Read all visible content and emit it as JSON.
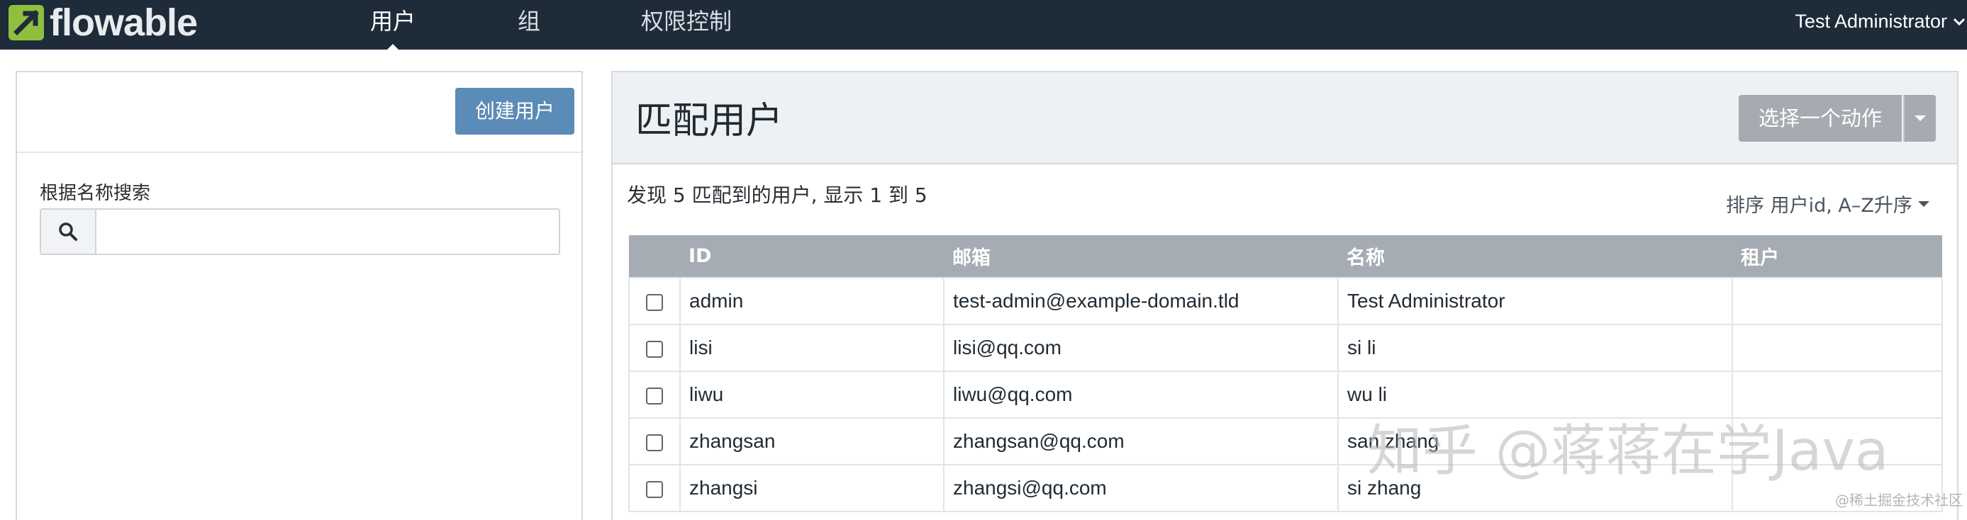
{
  "app": {
    "logo_text": "flowable",
    "nav": [
      "用户",
      "组",
      "权限控制"
    ],
    "user_menu": "Test Administrator"
  },
  "left_panel": {
    "create_button": "创建用户",
    "search_label": "根据名称搜索",
    "search_value": "",
    "search_icon": "search-icon"
  },
  "main": {
    "title": "匹配用户",
    "action_button": "选择一个动作",
    "result_summary": "发现 5 匹配到的用户, 显示 1 到 5",
    "sort": "排序 用户id, A–Z升序",
    "table": {
      "headers": [
        "",
        "ID",
        "邮箱",
        "名称",
        "租户"
      ],
      "rows": [
        {
          "id": "admin",
          "email": "test-admin@example-domain.tld",
          "name": "Test Administrator",
          "tenant": ""
        },
        {
          "id": "lisi",
          "email": "lisi@qq.com",
          "name": "si li",
          "tenant": ""
        },
        {
          "id": "liwu",
          "email": "liwu@qq.com",
          "name": "wu li",
          "tenant": ""
        },
        {
          "id": "zhangsan",
          "email": "zhangsan@qq.com",
          "name": "san zhang",
          "tenant": ""
        },
        {
          "id": "zhangsi",
          "email": "zhangsi@qq.com",
          "name": "si zhang",
          "tenant": ""
        }
      ]
    }
  },
  "watermark": {
    "main": "知乎 @蒋蒋在学Java",
    "small": "@稀土掘金技术社区"
  },
  "colors": {
    "navbar": "#1e2b39",
    "logo_green": "#8fbf3f",
    "primary_button": "#5b8bb7",
    "table_header": "#a6acb3"
  }
}
